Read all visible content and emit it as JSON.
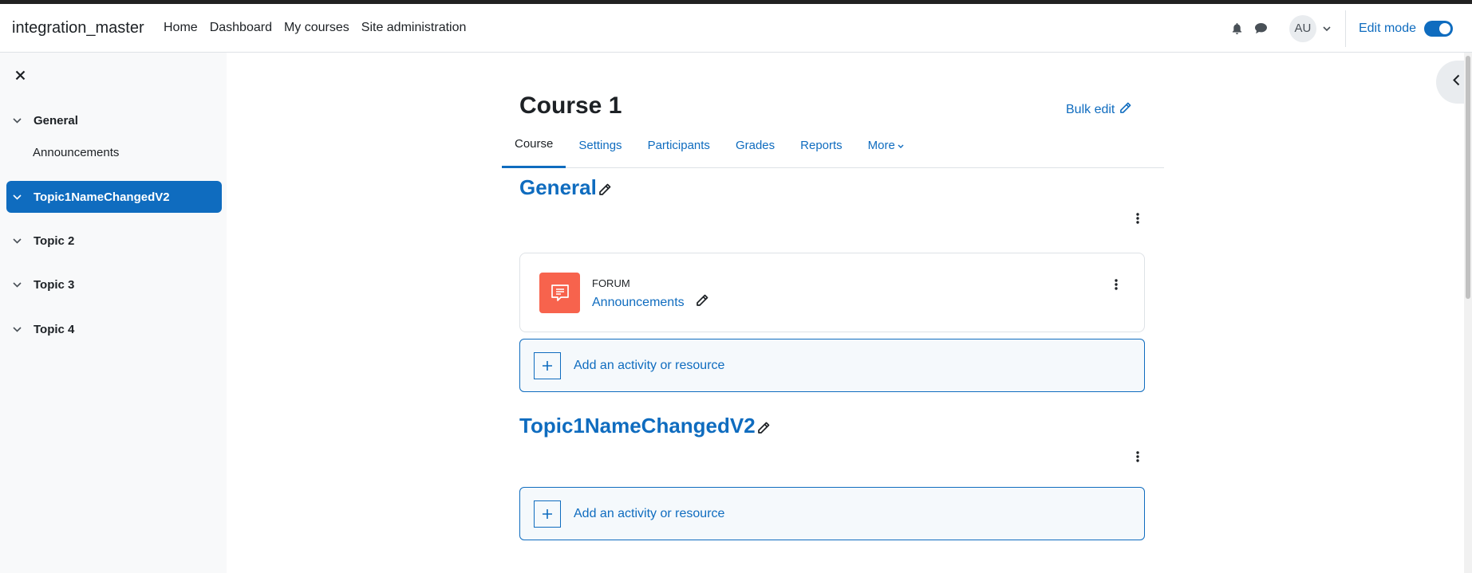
{
  "navbar": {
    "brand": "integration_master",
    "items": [
      {
        "label": "Home"
      },
      {
        "label": "Dashboard"
      },
      {
        "label": "My courses"
      },
      {
        "label": "Site administration"
      }
    ],
    "avatar_initials": "AU",
    "edit_mode_label": "Edit mode",
    "edit_mode_on": true
  },
  "drawer": {
    "sections": [
      {
        "label": "General",
        "activities": [
          "Announcements"
        ],
        "active": false
      },
      {
        "label": "Topic1NameChangedV2",
        "activities": [],
        "active": true
      },
      {
        "label": "Topic 2",
        "activities": [],
        "active": false
      },
      {
        "label": "Topic 3",
        "activities": [],
        "active": false
      },
      {
        "label": "Topic 4",
        "activities": [],
        "active": false
      }
    ]
  },
  "course": {
    "title": "Course 1",
    "bulk_edit_label": "Bulk edit",
    "tabs": [
      {
        "label": "Course",
        "active": true
      },
      {
        "label": "Settings"
      },
      {
        "label": "Participants"
      },
      {
        "label": "Grades"
      },
      {
        "label": "Reports"
      },
      {
        "label": "More"
      }
    ],
    "sections": [
      {
        "title": "General",
        "activity": {
          "type": "FORUM",
          "name": "Announcements"
        },
        "add_label": "Add an activity or resource"
      },
      {
        "title": "Topic1NameChangedV2",
        "add_label": "Add an activity or resource"
      }
    ]
  },
  "colors": {
    "accent": "#0f6cbf",
    "forum_icon_bg": "#f7634d",
    "drawer_bg": "#f8f9fa"
  }
}
